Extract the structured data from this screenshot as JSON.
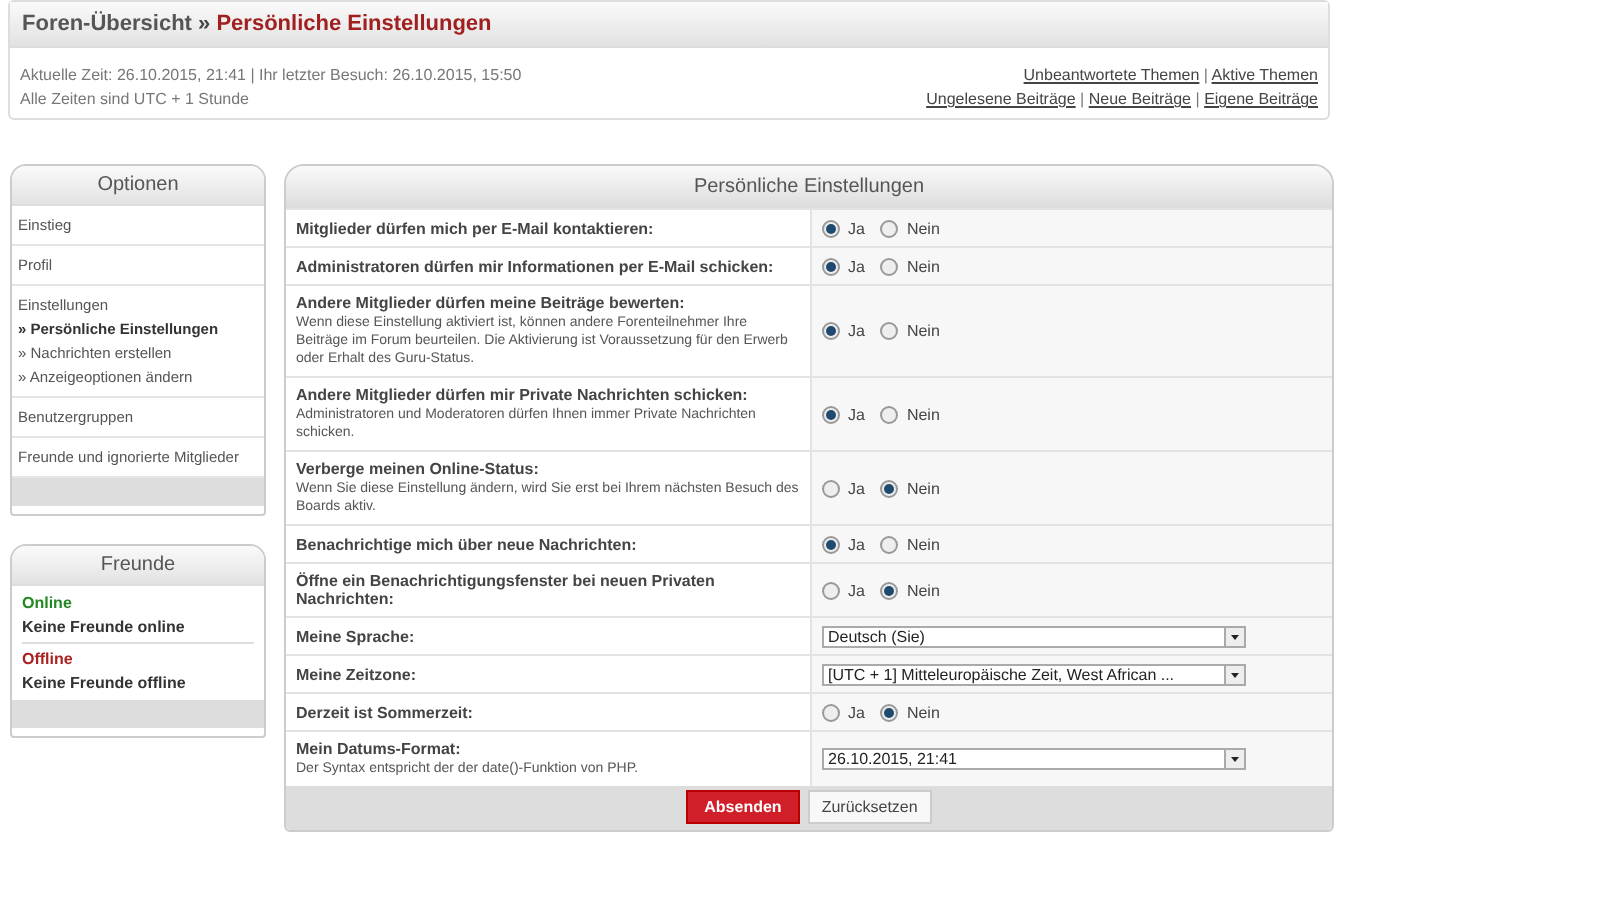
{
  "breadcrumb": {
    "home": "Foren-Übersicht",
    "separator": "»",
    "current": "Persönliche Einstellungen"
  },
  "info": {
    "lines": [
      "Aktuelle Zeit: 26.10.2015, 21:41 | Ihr letzter Besuch: 26.10.2015, 15:50",
      "Alle Zeiten sind UTC + 1 Stunde"
    ],
    "link_separator": "|",
    "links": [
      [
        "Unbeantwortete Themen",
        "Aktive Themen"
      ],
      [
        "Ungelesene Beiträge",
        "Neue Beiträge",
        "Eigene Beiträge"
      ]
    ]
  },
  "options": {
    "title": "Optionen",
    "items": [
      {
        "label": "Einstieg"
      },
      {
        "label": "Profil"
      },
      {
        "label": "Einstellungen",
        "children": [
          {
            "label": "» Persönliche Einstellungen",
            "selected": true
          },
          {
            "label": "» Nachrichten erstellen",
            "selected": false
          },
          {
            "label": "» Anzeigeoptionen ändern",
            "selected": false
          }
        ]
      },
      {
        "label": "Benutzergruppen"
      },
      {
        "label": "Freunde und ignorierte Mitglieder"
      }
    ]
  },
  "friends": {
    "title": "Freunde",
    "groups": [
      {
        "status": "Online",
        "color": "#228822",
        "text": "Keine Freunde online"
      },
      {
        "status": "Offline",
        "color": "#aa2222",
        "text": "Keine Freunde offline"
      }
    ]
  },
  "settings": {
    "title": "Persönliche Einstellungen",
    "rows": [
      {
        "kind": "radio",
        "label": "Mitglieder dürfen mich per E-Mail kontaktieren:",
        "options": [
          {
            "label": "Ja",
            "selected": true
          },
          {
            "label": "Nein",
            "selected": false
          }
        ]
      },
      {
        "kind": "radio",
        "label": "Administratoren dürfen mir Informationen per E-Mail schicken:",
        "options": [
          {
            "label": "Ja",
            "selected": true
          },
          {
            "label": "Nein",
            "selected": false
          }
        ]
      },
      {
        "kind": "radio",
        "label": "Andere Mitglieder dürfen meine Beiträge bewerten:",
        "hint": "Wenn diese Einstellung aktiviert ist, können andere Forenteilnehmer Ihre Beiträge im Forum beurteilen. Die Aktivierung ist Voraussetzung für den Erwerb oder Erhalt des Guru-Status.",
        "options": [
          {
            "label": "Ja",
            "selected": true
          },
          {
            "label": "Nein",
            "selected": false
          }
        ]
      },
      {
        "kind": "radio",
        "label": "Andere Mitglieder dürfen mir Private Nachrichten schicken:",
        "hint": "Administratoren und Moderatoren dürfen Ihnen immer Private Nachrichten schicken.",
        "options": [
          {
            "label": "Ja",
            "selected": true
          },
          {
            "label": "Nein",
            "selected": false
          }
        ]
      },
      {
        "kind": "radio",
        "label": "Verberge meinen Online-Status:",
        "hint": "Wenn Sie diese Einstellung ändern, wird Sie erst bei Ihrem nächsten Besuch des Boards aktiv.",
        "options": [
          {
            "label": "Ja",
            "selected": false
          },
          {
            "label": "Nein",
            "selected": true
          }
        ]
      },
      {
        "kind": "radio",
        "label": "Benachrichtige mich über neue Nachrichten:",
        "options": [
          {
            "label": "Ja",
            "selected": true
          },
          {
            "label": "Nein",
            "selected": false
          }
        ]
      },
      {
        "kind": "radio",
        "label": "Öffne ein Benachrichtigungsfenster bei neuen Privaten Nachrichten:",
        "options": [
          {
            "label": "Ja",
            "selected": false
          },
          {
            "label": "Nein",
            "selected": true
          }
        ]
      },
      {
        "kind": "select",
        "label": "Meine Sprache:",
        "value": "Deutsch (Sie)"
      },
      {
        "kind": "select",
        "label": "Meine Zeitzone:",
        "value": "[UTC + 1] Mitteleuropäische Zeit, West African ..."
      },
      {
        "kind": "radio",
        "label": "Derzeit ist Sommerzeit:",
        "options": [
          {
            "label": "Ja",
            "selected": false
          },
          {
            "label": "Nein",
            "selected": true
          }
        ]
      },
      {
        "kind": "select",
        "label": "Mein Datums-Format:",
        "hint": "Der Syntax entspricht der der date()-Funktion von PHP.",
        "value": "26.10.2015, 21:41"
      }
    ],
    "buttons": {
      "submit": "Absenden",
      "reset": "Zurücksetzen"
    }
  }
}
